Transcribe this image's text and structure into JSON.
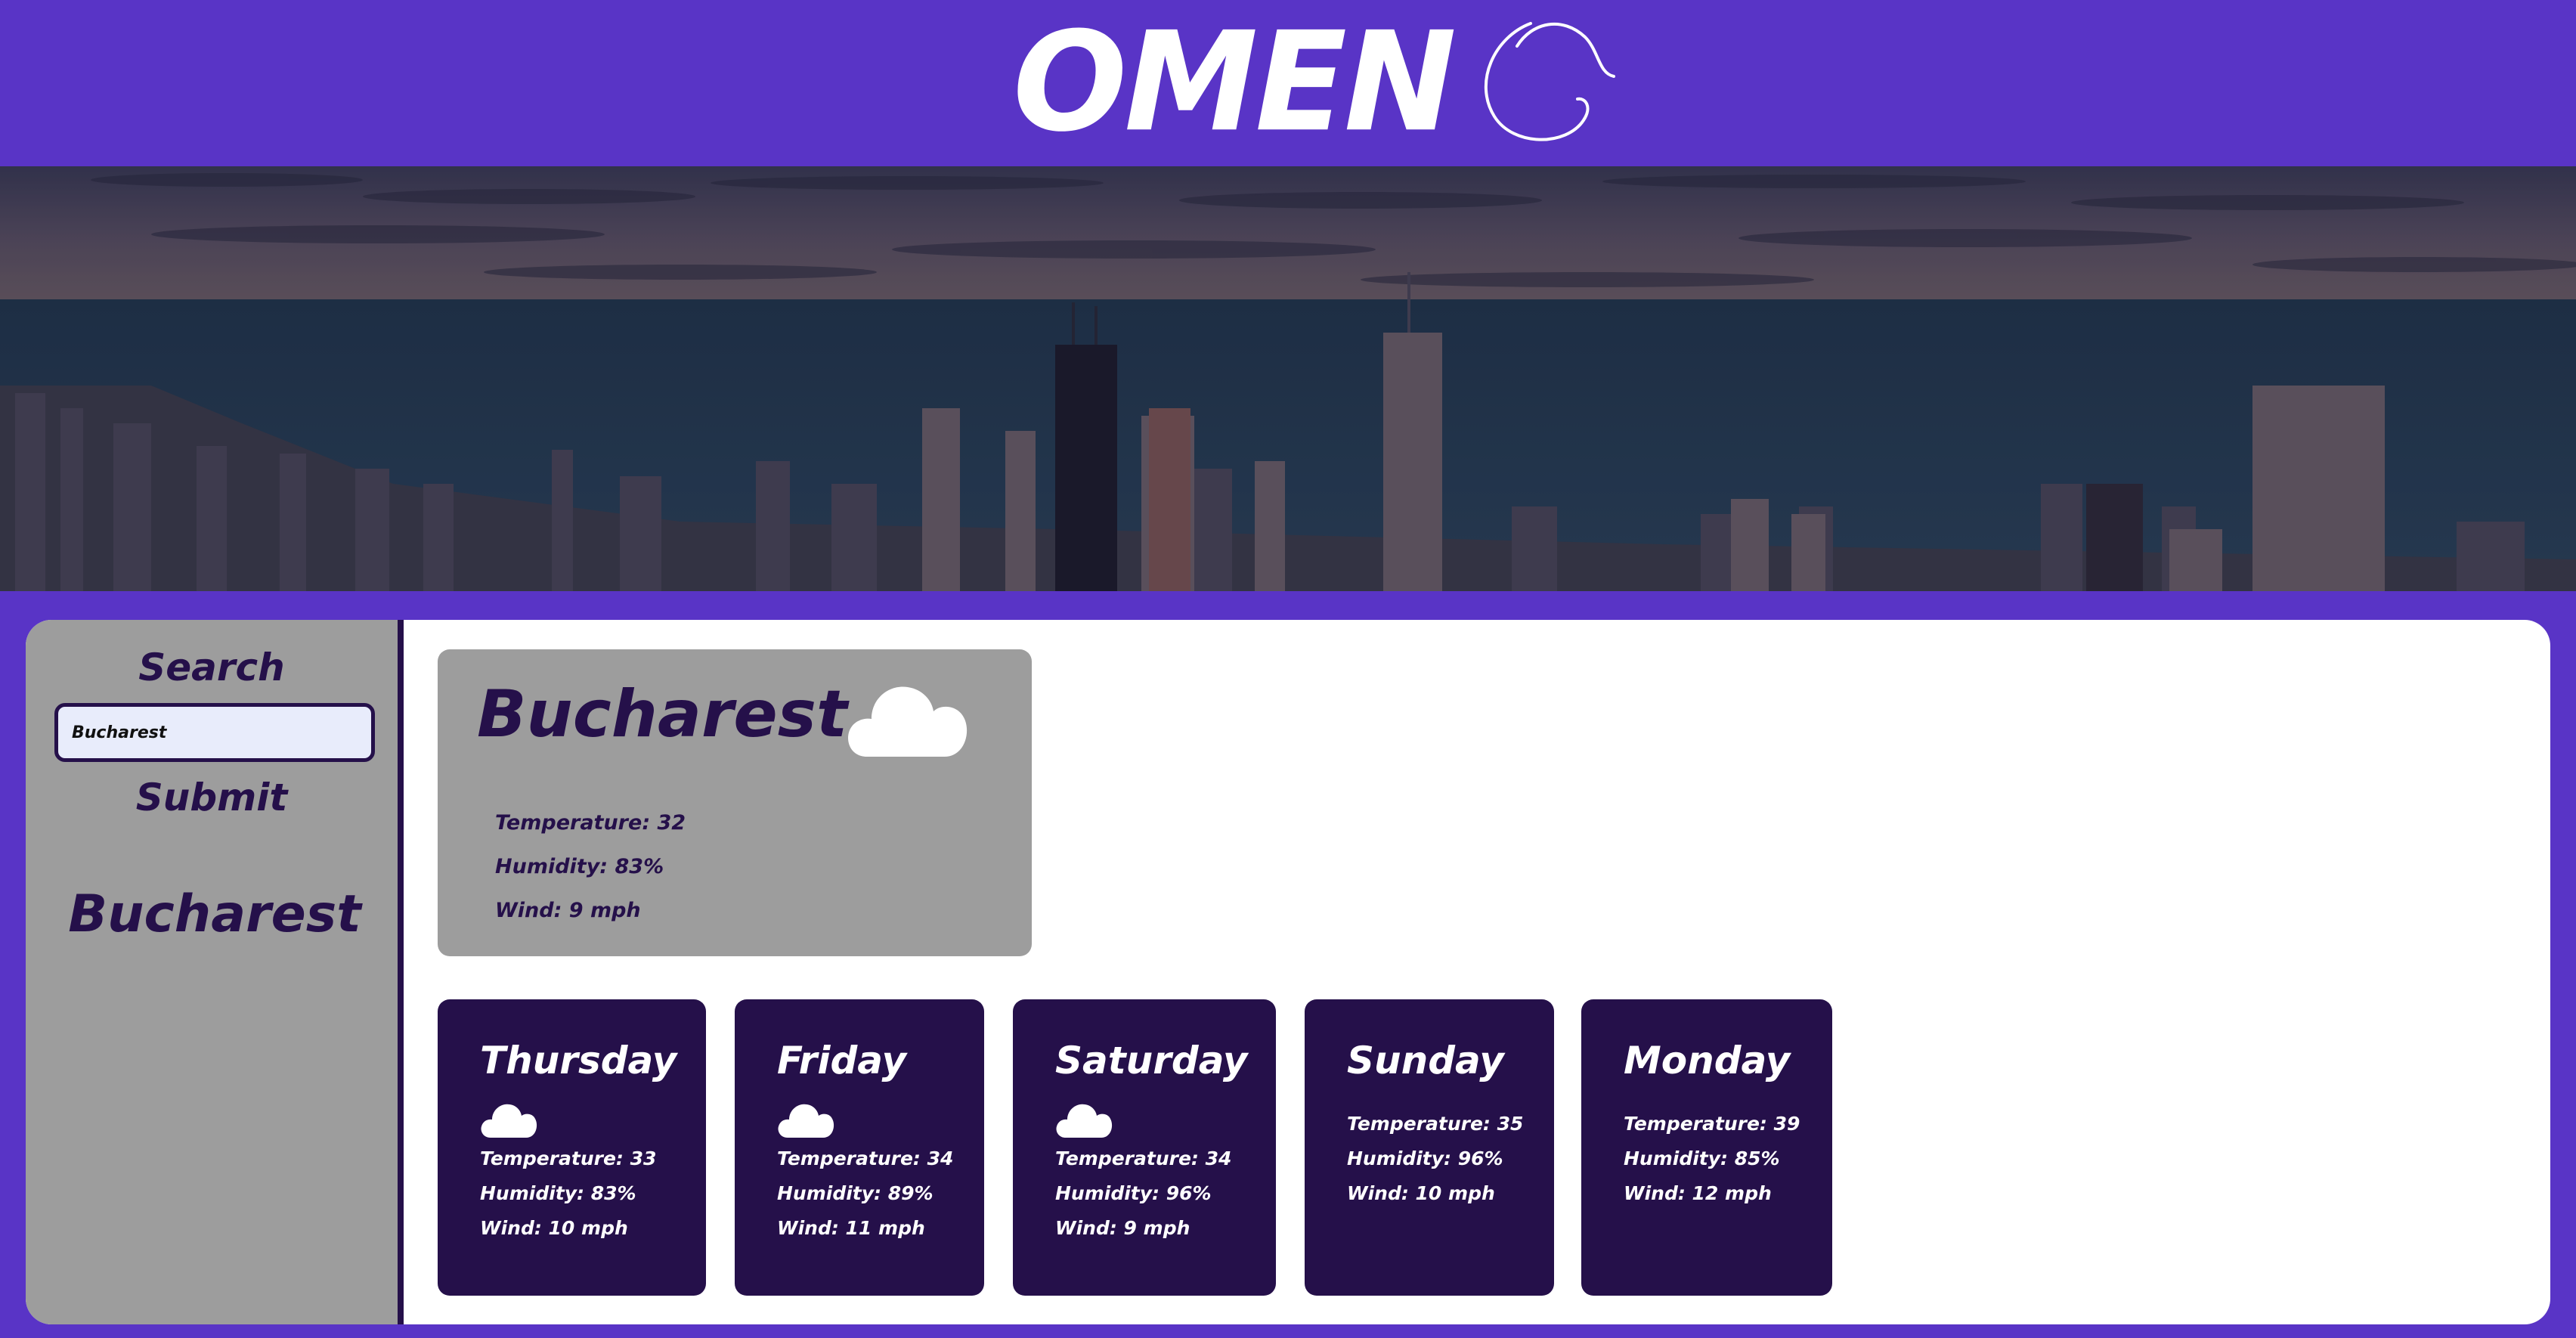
{
  "header": {
    "logo_text": "OMEN"
  },
  "search": {
    "heading": "Search",
    "input_value": "Bucharest",
    "submit_label": "Submit",
    "history": [
      "Bucharest"
    ]
  },
  "current": {
    "city": "Bucharest",
    "icon": "cloud-icon",
    "temperature": "Temperature: 32",
    "humidity": "Humidity: 83%",
    "wind": "Wind: 9 mph"
  },
  "forecast": [
    {
      "day": "Thursday",
      "icon": "cloud-icon",
      "temperature": "Temperature: 33",
      "humidity": "Humidity: 83%",
      "wind": "Wind: 10 mph"
    },
    {
      "day": "Friday",
      "icon": "cloud-icon",
      "temperature": "Temperature: 34",
      "humidity": "Humidity: 89%",
      "wind": "Wind: 11 mph"
    },
    {
      "day": "Saturday",
      "icon": "cloud-icon",
      "temperature": "Temperature: 34",
      "humidity": "Humidity: 96%",
      "wind": "Wind: 9 mph"
    },
    {
      "day": "Sunday",
      "icon": null,
      "temperature": "Temperature: 35",
      "humidity": "Humidity: 96%",
      "wind": "Wind: 10 mph"
    },
    {
      "day": "Monday",
      "icon": null,
      "temperature": "Temperature: 39",
      "humidity": "Humidity: 85%",
      "wind": "Wind: 12 mph"
    }
  ],
  "colors": {
    "brand": "#5934c6",
    "dark": "#25104a",
    "panel_gray": "#9d9d9d",
    "input_bg": "#e8ecfb"
  }
}
